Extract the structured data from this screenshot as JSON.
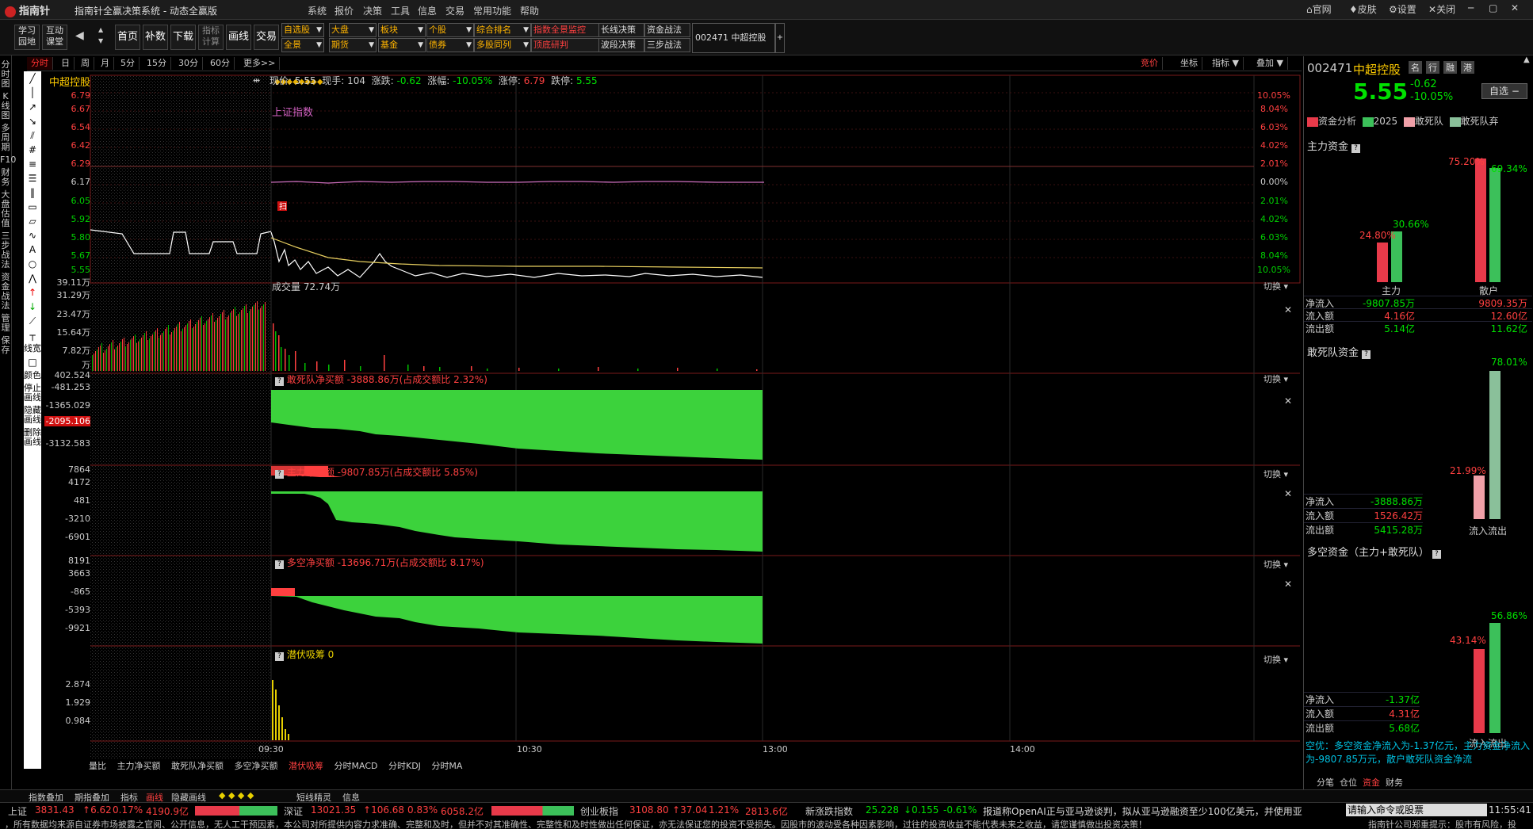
{
  "titlebar": {
    "logo": "指南针",
    "app_title": "指南针全赢决策系统 - 动态全赢版",
    "menus": [
      "系统",
      "报价",
      "决策",
      "工具",
      "信息",
      "交易",
      "常用功能",
      "帮助"
    ],
    "right_buttons": [
      "官网",
      "皮肤",
      "设置",
      "关闭"
    ]
  },
  "toolbar": {
    "left_buttons": [
      "学习\n园地",
      "互动\n课堂"
    ],
    "big_buttons": [
      "首页",
      "补数",
      "下载",
      "指标\n计算",
      "画线",
      "交易"
    ],
    "row1_dropdowns": [
      "自选股",
      "大盘",
      "板块",
      "个股",
      "综合排名",
      "指数全景监控",
      "长线决策",
      "资金战法"
    ],
    "row2_dropdowns": [
      "全景",
      "期货",
      "基金",
      "债券",
      "多股同列",
      "顶底研判",
      "波段决策",
      "三步战法"
    ],
    "code_box": "002471 中超控股"
  },
  "periods": [
    "分时",
    "日",
    "周",
    "月",
    "5分",
    "15分",
    "30分",
    "60分",
    "更多>>"
  ],
  "right_tools": [
    "竞价",
    "坐标",
    "指标",
    "叠加"
  ],
  "left_nav": [
    "分时图",
    "K线图",
    "多周期",
    "F10",
    "财务",
    "大盘估值",
    "三步战法",
    "资金战法",
    "管理",
    "保存"
  ],
  "draw_tools_text": [
    "线宽",
    "颜色",
    "停止画线",
    "隐藏画线",
    "删除画线"
  ],
  "main": {
    "stock_name": "中超控股",
    "info_labels": [
      "现价:",
      "现手:",
      "涨跌:",
      "涨幅:",
      "涨停:",
      "跌停:"
    ],
    "info_values": [
      "5.55",
      "104",
      "-0.62",
      "-10.05%",
      "6.79",
      "5.55"
    ],
    "index_label": "上证指数",
    "price_axis": [
      "6.79",
      "6.67",
      "6.54",
      "6.42",
      "6.29",
      "6.17",
      "6.05",
      "5.92",
      "5.80",
      "5.67",
      "5.55"
    ],
    "pct_axis": [
      "10.05%",
      "8.04%",
      "6.03%",
      "4.02%",
      "2.01%",
      "0.00%",
      "2.01%",
      "4.02%",
      "6.03%",
      "8.04%",
      "10.05%"
    ],
    "vol_axis": [
      "39.11万",
      "31.29万",
      "23.47万",
      "15.64万",
      "7.82万",
      "万"
    ],
    "volume_title": "成交量  72.74万",
    "panel2_title": "敢死队净买额  -3888.86万(占成交额比 2.32%)",
    "panel2_axis": [
      "402.524",
      "-481.253",
      "-1365.029",
      "-2095.106",
      "-3132.583"
    ],
    "panel3_title": "主力净买额  -9807.85万(占成交额比 5.85%)",
    "panel3_axis": [
      "7864",
      "4172",
      "481",
      "-3210",
      "-6901"
    ],
    "panel4_title": "多空净买额  -13696.71万(占成交额比 8.17%)",
    "panel4_axis": [
      "8191",
      "3663",
      "-865",
      "-5393",
      "-9921"
    ],
    "panel5_title": "潜伏吸筹  0",
    "panel5_axis": [
      "2.874",
      "1.929",
      "0.984"
    ],
    "switch_label": "切换",
    "time_labels": [
      "09:30",
      "10:30",
      "13:00",
      "14:00"
    ],
    "sub_tabs": [
      "量比",
      "主力净买额",
      "敢死队净买额",
      "多空净买额",
      "潜伏吸筹",
      "分时MACD",
      "分时KDJ",
      "分时MA"
    ],
    "active_sub_tab": "潜伏吸筹"
  },
  "right_panel": {
    "code": "002471",
    "name": "中超控股",
    "tabs": [
      "名",
      "行",
      "融",
      "港"
    ],
    "price": "5.55",
    "change": "-0.62",
    "change_pct": "-10.05%",
    "watchlist_btn": "自选",
    "legend": [
      "资金分析",
      "2025",
      "敢死队",
      "敢死队弃"
    ],
    "main_fund_title": "主力资金",
    "main_fund_labels": [
      "主力",
      "散户"
    ],
    "main_fund_pcts": [
      "24.80%",
      "30.66%",
      "75.20%",
      "69.34%"
    ],
    "main_fund_rows": [
      {
        "label": "净流入",
        "a": "-9807.85万",
        "b": "9809.35万"
      },
      {
        "label": "流入额",
        "a": "4.16亿",
        "b": "12.60亿"
      },
      {
        "label": "流出额",
        "a": "5.14亿",
        "b": "11.62亿"
      }
    ],
    "dare_title": "敢死队资金",
    "dare_pcts": [
      "21.99%",
      "78.01%"
    ],
    "dare_rows": [
      {
        "label": "净流入",
        "v": "-3888.86万"
      },
      {
        "label": "流入额",
        "v": "1526.42万"
      },
      {
        "label": "流出额",
        "v": "5415.28万"
      }
    ],
    "inout_labels": [
      "流入",
      "流出"
    ],
    "long_short_title": "多空资金（主力+敢死队）",
    "long_short_pcts": [
      "43.14%",
      "56.86%"
    ],
    "long_short_rows": [
      {
        "label": "净流入",
        "v": "-1.37亿"
      },
      {
        "label": "流入额",
        "v": "4.31亿"
      },
      {
        "label": "流出额",
        "v": "5.68亿"
      }
    ],
    "summary": "空优：多空资金净流入为-1.37亿元，主力资金净流入为-9807.85万元，散户敢死队资金净流",
    "bottom_tabs": [
      "分笔",
      "仓位",
      "资金",
      "财务"
    ]
  },
  "statusbar": {
    "items": [
      "指数叠加",
      "期指叠加",
      "指标",
      "画线",
      "隐藏画线",
      "短线精灵",
      "信息"
    ]
  },
  "ticker": {
    "sh": {
      "label": "上证",
      "v": "3831.43",
      "chg": "6.62",
      "pct": "0.17%",
      "amt": "4190.9亿"
    },
    "sz": {
      "label": "深证",
      "v": "13021.35",
      "chg": "106.68",
      "pct": "0.83%",
      "amt": "6058.2亿"
    },
    "cy": {
      "label": "创业板指",
      "v": "3108.80",
      "chg": "37.04",
      "pct": "1.21%",
      "amt": "2813.6亿"
    },
    "nh": {
      "label": "新涨跌指数",
      "v": "25.228",
      "chg": "0.155",
      "pct": "-0.61%"
    },
    "news": "报道称OpenAI正与亚马逊谈判，拟从亚马逊融资至少100亿美元，并使用亚",
    "cmd_placeholder": "请输入命令或股票",
    "clock": "11:55:41"
  },
  "disclaimer": "，所有数据均来源自证券市场披露之官阅、公开信息，无人工干预因素，本公司对所提供内容力求准确、完整和及时，但并不对其准确性、完整性和及时性做出任何保证，亦无法保证您的投资不受损失。因股市的波动受各种因素影响，过往的投资收益不能代表未来之收益，请您谨慎做出投资决策！",
  "disclaimer_right": "指南针公司郑重提示：股市有风险，投"
}
